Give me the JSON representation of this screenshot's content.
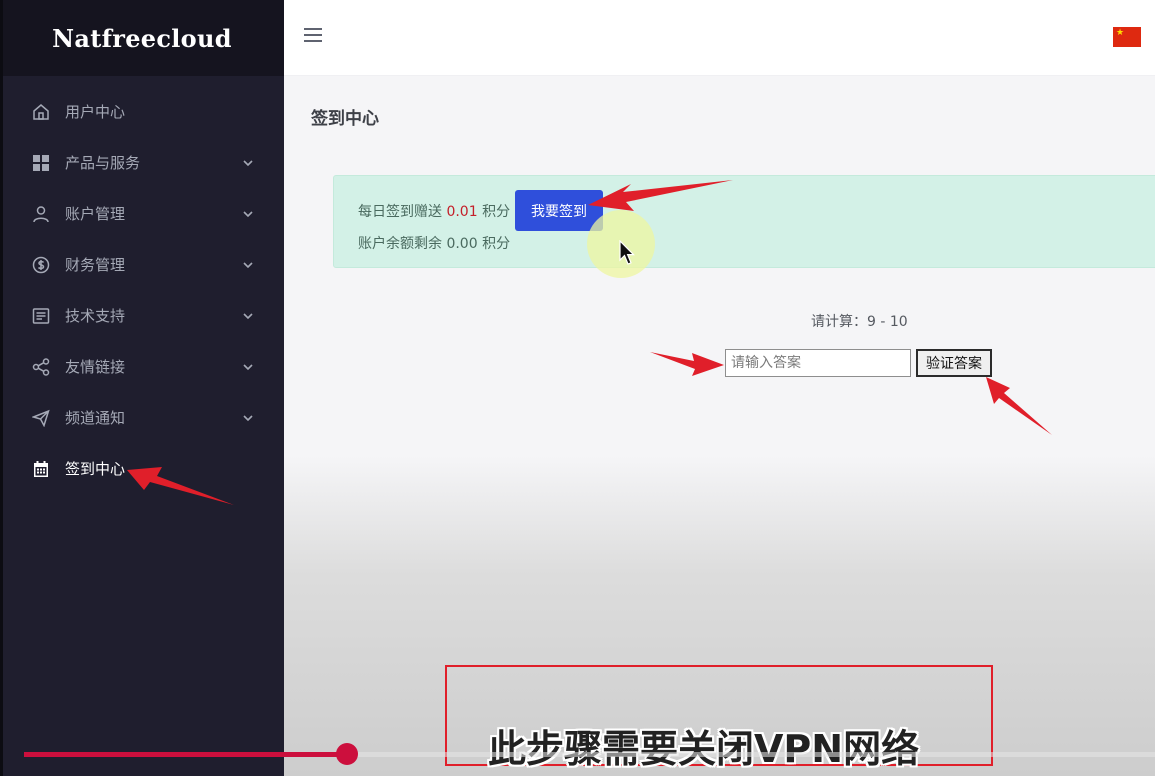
{
  "brand": "Natfreecloud",
  "sidebar": {
    "items": [
      {
        "label": "用户中心",
        "icon": "home-icon",
        "has_chevron": false
      },
      {
        "label": "产品与服务",
        "icon": "grid-icon",
        "has_chevron": true
      },
      {
        "label": "账户管理",
        "icon": "user-icon",
        "has_chevron": true
      },
      {
        "label": "财务管理",
        "icon": "dollar-icon",
        "has_chevron": true
      },
      {
        "label": "技术支持",
        "icon": "document-icon",
        "has_chevron": true
      },
      {
        "label": "友情链接",
        "icon": "share-icon",
        "has_chevron": true
      },
      {
        "label": "频道通知",
        "icon": "send-icon",
        "has_chevron": true
      },
      {
        "label": "签到中心",
        "icon": "calendar-icon",
        "has_chevron": false,
        "active": true
      }
    ]
  },
  "header": {
    "menu_icon": "hamburger-icon",
    "language_flag": "china-flag-icon"
  },
  "main": {
    "page_title": "签到中心",
    "checkin": {
      "daily_prefix": "每日签到赠送",
      "daily_amount": "0.01",
      "daily_unit": "积分",
      "button_label": "我要签到",
      "balance_text": "账户余额剩余 0.00 积分"
    },
    "captcha": {
      "question": "请计算：9 - 10",
      "input_placeholder": "请输入答案",
      "input_value": "",
      "verify_label": "验证答案"
    }
  },
  "video": {
    "subtitle": "此步骤需要关闭VPN网络",
    "progress": 0.286
  },
  "colors": {
    "sidebar_bg": "#1f1e2e",
    "accent_button": "#2f4fdb",
    "alert_bg": "#d3f1e7",
    "amount_red": "#c4202a",
    "annotation_red": "#e01f2a",
    "progress": "#cc0f3d"
  }
}
